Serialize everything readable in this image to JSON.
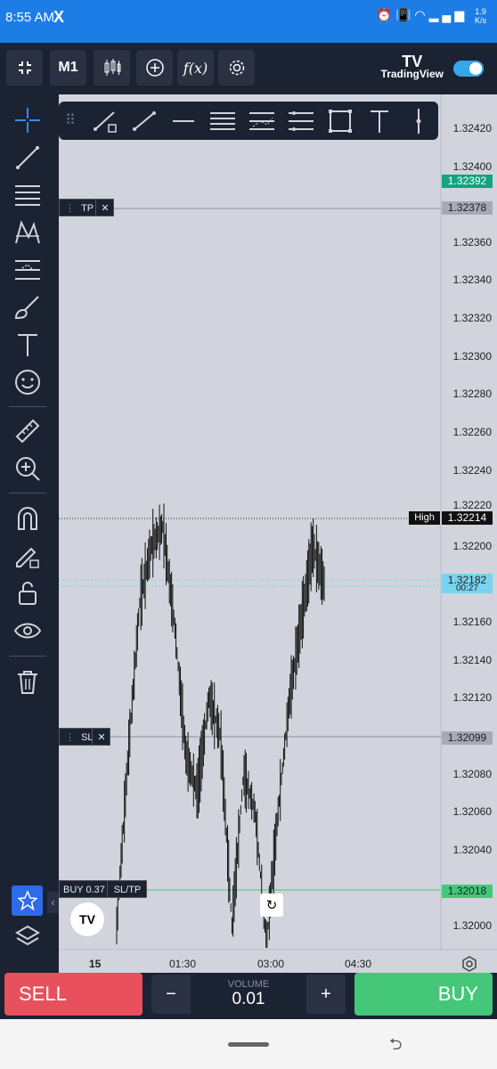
{
  "status_bar": {
    "time": "8:55 AM",
    "app_icon": "X",
    "net_speed_value": "1.9",
    "net_speed_unit": "K/s"
  },
  "toolbar": {
    "timeframe": "M1",
    "brand_name": "TradingView",
    "brand_logo": "TV",
    "fx_label": "f(x)"
  },
  "price_axis": {
    "labels": [
      "1.32420",
      "1.32400",
      "1.32360",
      "1.32340",
      "1.32320",
      "1.32300",
      "1.32280",
      "1.32260",
      "1.32240",
      "1.32200",
      "1.32160",
      "1.32140",
      "1.32120",
      "1.32080",
      "1.32060",
      "1.32040",
      "1.32000"
    ],
    "partial_label": "1.32220",
    "badges": {
      "current": "1.32392",
      "tp": "1.32378",
      "high": "1.32214",
      "bid": "1.32182",
      "bid_sub": "00:27",
      "sl": "1.32099",
      "buy": "1.32018"
    },
    "high_label": "High"
  },
  "orders": {
    "tp_label": "TP",
    "sl_label": "SL",
    "buy_label": "BUY 0.37",
    "sltp_label": "SL/TP",
    "close_glyph": "✕"
  },
  "time_axis": [
    "15",
    "01:30",
    "03:00",
    "04:30"
  ],
  "trade_bar": {
    "sell_label": "SELL",
    "buy_label": "BUY",
    "volume_label": "VOLUME",
    "volume_value": "0.01",
    "minus": "−",
    "plus": "+"
  },
  "colors": {
    "sell": "#e8505d",
    "buy": "#45c77a",
    "panel": "#1b2232",
    "chart_bg": "#d1d4dc",
    "bid_line": "#7ad3ef",
    "accent": "#2f6be8"
  },
  "chart_data": {
    "type": "line",
    "x": [
      "15",
      "01:30",
      "03:00",
      "04:30"
    ],
    "ylim": [
      1.3199,
      1.3243
    ],
    "series": [
      {
        "values": [
          1.32,
          1.3209,
          1.3217,
          1.322,
          1.3221,
          1.3216,
          1.3209,
          1.3207,
          1.3212,
          1.321,
          1.32,
          1.3208,
          1.3206,
          1.3199,
          1.3206,
          1.3212,
          1.3216,
          1.322,
          1.3218
        ]
      }
    ],
    "levels": {
      "tp": 1.32378,
      "high": 1.32214,
      "bid": 1.32182,
      "sl": 1.32099,
      "buy": 1.32018
    }
  }
}
